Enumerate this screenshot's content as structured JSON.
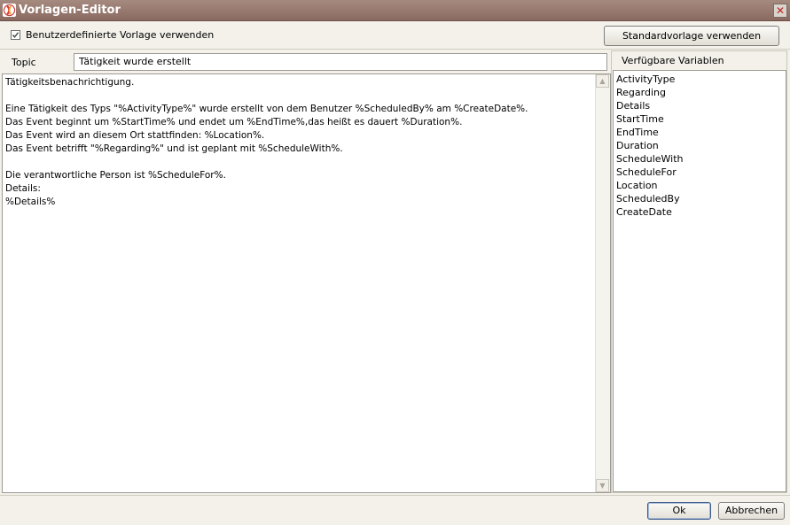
{
  "window": {
    "title": "Vorlagen-Editor",
    "close_symbol": "✕",
    "icon": "app-logo-icon"
  },
  "options": {
    "custom_template_label": "Benutzerdefinierte Vorlage verwenden",
    "custom_template_checked": true,
    "standard_template_button": "Standardvorlage verwenden"
  },
  "topic": {
    "label": "Topic",
    "value": "Tätigkeit wurde erstellt"
  },
  "body": {
    "text": "Tätigkeitsbenachrichtigung.\n\nEine Tätigkeit des Typs \"%ActivityType%\" wurde erstellt von dem Benutzer %ScheduledBy% am %CreateDate%.\nDas Event beginnt um %StartTime% und endet um %EndTime%,das heißt es dauert %Duration%.\nDas Event wird an diesem Ort stattfinden: %Location%.\nDas Event betrifft \"%Regarding%\" und ist geplant mit %ScheduleWith%.\n\nDie verantwortliche Person ist %ScheduleFor%.\nDetails:\n%Details%"
  },
  "variables": {
    "header": "Verfügbare Variablen",
    "items": [
      "ActivityType",
      "Regarding",
      "Details",
      "StartTime",
      "EndTime",
      "Duration",
      "ScheduleWith",
      "ScheduleFor",
      "Location",
      "ScheduledBy",
      "CreateDate"
    ]
  },
  "footer": {
    "ok_label": "Ok",
    "cancel_label": "Abbrechen"
  }
}
